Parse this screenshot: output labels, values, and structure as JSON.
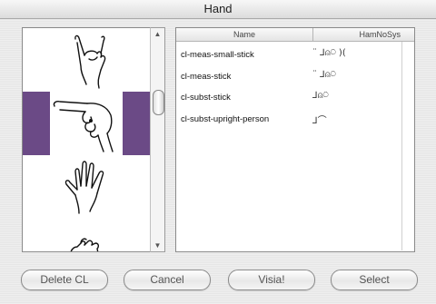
{
  "window": {
    "title": "Hand"
  },
  "table": {
    "columns": [
      "Name",
      "HamNoSys"
    ],
    "rows": [
      {
        "name": "cl-meas-small-stick",
        "hamnosys": "¨ ⅃⍝⍥ )("
      },
      {
        "name": "cl-meas-stick",
        "hamnosys": "¨ ⅃⍝⍥"
      },
      {
        "name": "cl-subst-stick",
        "hamnosys": "⅃⍝⍥"
      },
      {
        "name": "cl-subst-upright-person",
        "hamnosys": "⅃⌒"
      }
    ]
  },
  "buttons": {
    "delete": "Delete CL",
    "cancel": "Cancel",
    "visia": "Visia!",
    "select": "Select"
  },
  "hand_shapes": [
    "pinky-extended-hand",
    "index-pointing-hand",
    "open-spread-hand",
    "bent-hand"
  ]
}
